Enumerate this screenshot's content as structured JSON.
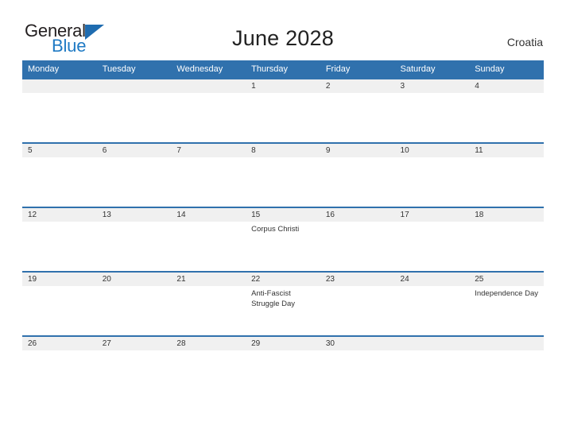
{
  "brand": {
    "name_part1": "General",
    "name_part2": "Blue",
    "flag_icon": "triangle-flag-icon",
    "color_dark": "#231f20",
    "color_blue": "#1f7ac4"
  },
  "header": {
    "title": "June 2028",
    "country": "Croatia"
  },
  "calendar": {
    "accent_color": "#3071ad",
    "band_color": "#f0f0f0",
    "weekdays": [
      "Monday",
      "Tuesday",
      "Wednesday",
      "Thursday",
      "Friday",
      "Saturday",
      "Sunday"
    ],
    "weeks": [
      [
        {
          "date": "",
          "events": []
        },
        {
          "date": "",
          "events": []
        },
        {
          "date": "",
          "events": []
        },
        {
          "date": "1",
          "events": []
        },
        {
          "date": "2",
          "events": []
        },
        {
          "date": "3",
          "events": []
        },
        {
          "date": "4",
          "events": []
        }
      ],
      [
        {
          "date": "5",
          "events": []
        },
        {
          "date": "6",
          "events": []
        },
        {
          "date": "7",
          "events": []
        },
        {
          "date": "8",
          "events": []
        },
        {
          "date": "9",
          "events": []
        },
        {
          "date": "10",
          "events": []
        },
        {
          "date": "11",
          "events": []
        }
      ],
      [
        {
          "date": "12",
          "events": []
        },
        {
          "date": "13",
          "events": []
        },
        {
          "date": "14",
          "events": []
        },
        {
          "date": "15",
          "events": [
            "Corpus Christi"
          ]
        },
        {
          "date": "16",
          "events": []
        },
        {
          "date": "17",
          "events": []
        },
        {
          "date": "18",
          "events": []
        }
      ],
      [
        {
          "date": "19",
          "events": []
        },
        {
          "date": "20",
          "events": []
        },
        {
          "date": "21",
          "events": []
        },
        {
          "date": "22",
          "events": [
            "Anti-Fascist Struggle Day"
          ]
        },
        {
          "date": "23",
          "events": []
        },
        {
          "date": "24",
          "events": []
        },
        {
          "date": "25",
          "events": [
            "Independence Day"
          ]
        }
      ],
      [
        {
          "date": "26",
          "events": []
        },
        {
          "date": "27",
          "events": []
        },
        {
          "date": "28",
          "events": []
        },
        {
          "date": "29",
          "events": []
        },
        {
          "date": "30",
          "events": []
        },
        {
          "date": "",
          "events": []
        },
        {
          "date": "",
          "events": []
        }
      ]
    ]
  }
}
